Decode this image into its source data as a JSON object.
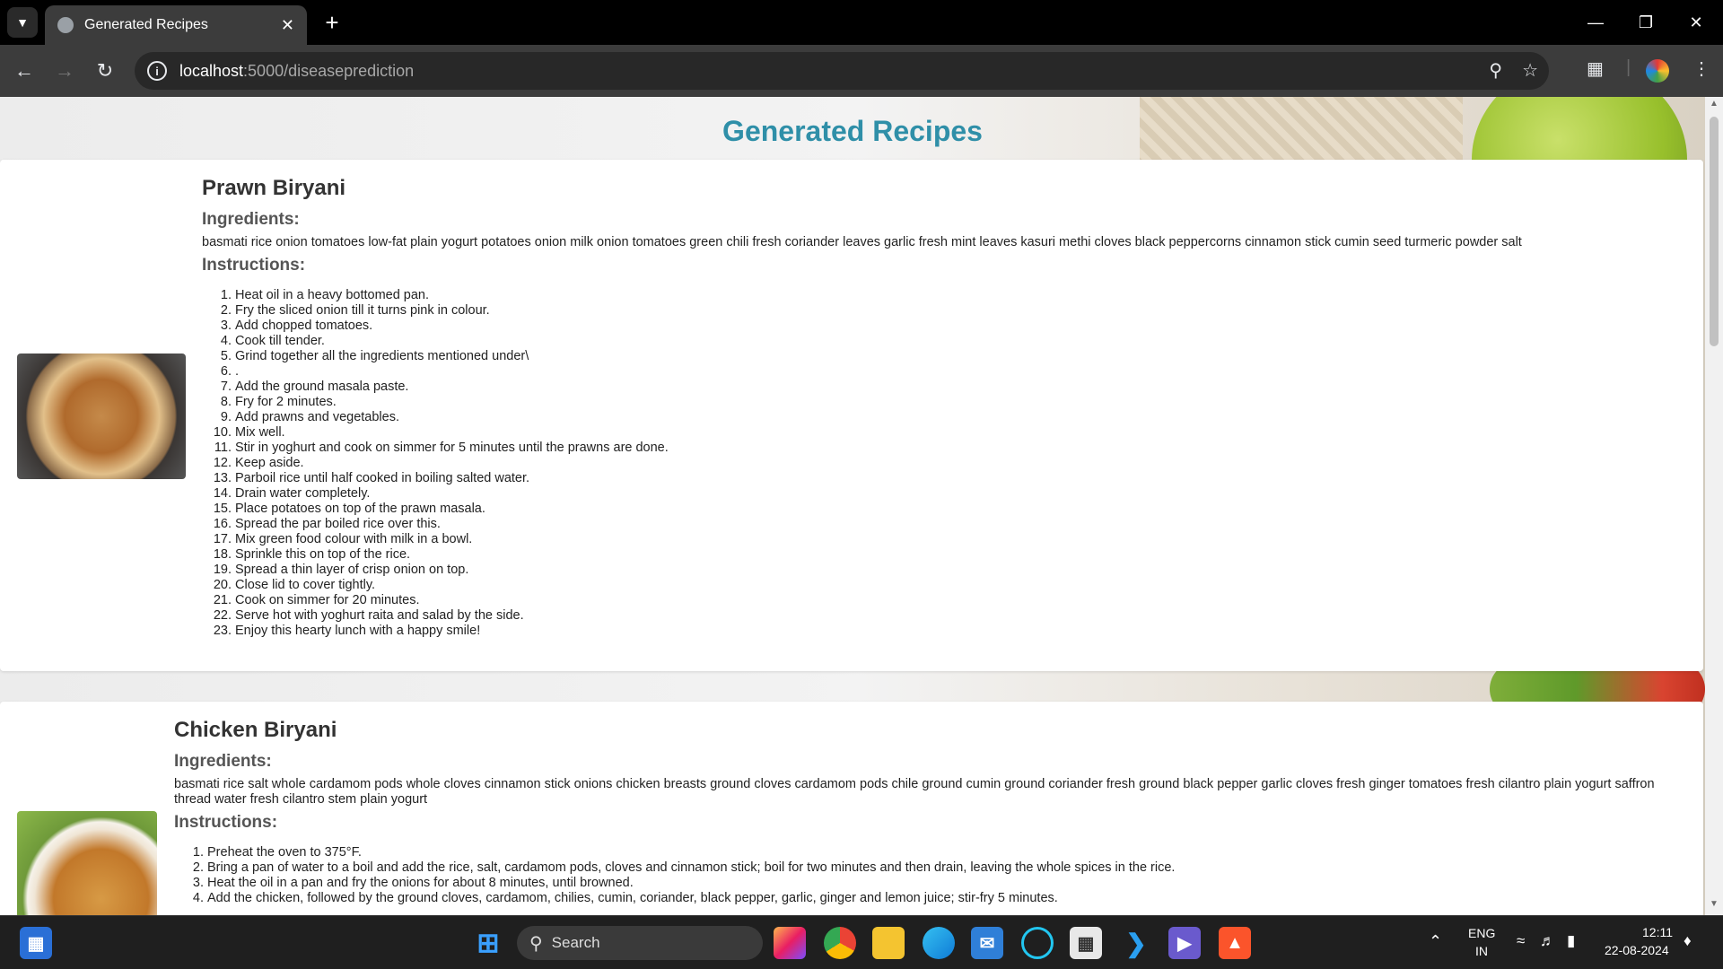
{
  "browser": {
    "tab_title": "Generated Recipes",
    "url_host": "localhost",
    "url_path": ":5000/diseaseprediction"
  },
  "page": {
    "title": "Generated Recipes"
  },
  "recipes": [
    {
      "name": "Prawn Biryani",
      "ingredients_heading": "Ingredients:",
      "ingredients": "basmati rice onion tomatoes low-fat plain yogurt potatoes onion milk onion tomatoes green chili fresh coriander leaves garlic fresh mint leaves kasuri methi cloves black peppercorns cinnamon stick cumin seed turmeric powder salt",
      "instructions_heading": "Instructions:",
      "instructions": [
        "Heat oil in a heavy bottomed pan.",
        "Fry the sliced onion till it turns pink in colour.",
        "Add chopped tomatoes.",
        "Cook till tender.",
        "Grind together all the ingredients mentioned under\\",
        ".",
        "Add the ground masala paste.",
        "Fry for 2 minutes.",
        "Add prawns and vegetables.",
        "Mix well.",
        "Stir in yoghurt and cook on simmer for 5 minutes until the prawns are done.",
        "Keep aside.",
        "Parboil rice until half cooked in boiling salted water.",
        "Drain water completely.",
        "Place potatoes on top of the prawn masala.",
        "Spread the par boiled rice over this.",
        "Mix green food colour with milk in a bowl.",
        "Sprinkle this on top of the rice.",
        "Spread a thin layer of crisp onion on top.",
        "Close lid to cover tightly.",
        "Cook on simmer for 20 minutes.",
        "Serve hot with yoghurt raita and salad by the side.",
        "Enjoy this hearty lunch with a happy smile!"
      ]
    },
    {
      "name": "Chicken Biryani",
      "ingredients_heading": "Ingredients:",
      "ingredients": "basmati rice salt whole cardamom pods whole cloves cinnamon stick onions chicken breasts ground cloves cardamom pods chile ground cumin ground coriander fresh ground black pepper garlic cloves fresh ginger tomatoes fresh cilantro plain yogurt saffron thread water fresh cilantro stem plain yogurt",
      "instructions_heading": "Instructions:",
      "instructions": [
        "Preheat the oven to 375°F.",
        "Bring a pan of water to a boil and add the rice, salt, cardamom pods, cloves and cinnamon stick; boil for two minutes and then drain, leaving the whole spices in the rice.",
        "Heat the oil in a pan and fry the onions for about 8 minutes, until browned.",
        "Add the chicken, followed by the ground cloves, cardamom, chilies, cumin, coriander, black pepper, garlic, ginger and lemon juice; stir-fry 5 minutes."
      ]
    }
  ],
  "taskbar": {
    "search_label": "Search",
    "lang_line1": "ENG",
    "lang_line2": "IN",
    "time": "12:11",
    "date": "22-08-2024"
  }
}
